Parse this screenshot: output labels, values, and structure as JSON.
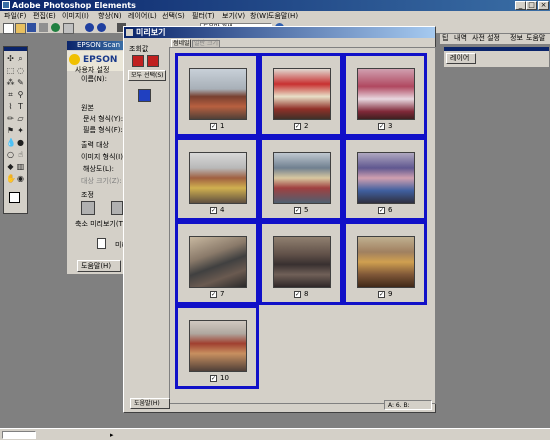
{
  "app": {
    "title": "Adobe Photoshop Elements",
    "menu": [
      "파일(F)",
      "편집(E)",
      "이미지(I)",
      "향상(N)",
      "레이어(L)",
      "선택(S)",
      "필터(T)",
      "보기(V)",
      "창(W)",
      "도움말(H)"
    ],
    "help_search": "도움말 검색",
    "right_tabs": [
      "팁",
      "내역",
      "사전 설정",
      "정보",
      "도움말"
    ],
    "right_panel_label": "레이어"
  },
  "epson": {
    "title": "EPSON Scan",
    "brand": "EPSON",
    "setting_label": "사용자 설정",
    "setting_name": "이름(N):",
    "sections": [
      "원본",
      "출력 대상",
      "조정"
    ],
    "items": [
      "문서 형식(Y):",
      "필름 형식(F):",
      "이미지 형식(I):",
      "해상도(L):",
      "대상 크기(Z):",
      "축소 미리보기(T)"
    ],
    "buttons": [
      "미리보기",
      "도움말(H)"
    ]
  },
  "preview_dialog": {
    "title": "미리보기",
    "tabs": [
      "썸네일",
      "일반 크기"
    ],
    "zoom_label": "조회값",
    "select_all": "모두 선택(S)",
    "help_button": "도움말(H)",
    "status": "A: 6. B:",
    "thumbnails": [
      {
        "label": "1",
        "checked": true
      },
      {
        "label": "2",
        "checked": true
      },
      {
        "label": "3",
        "checked": true
      },
      {
        "label": "4",
        "checked": true
      },
      {
        "label": "5",
        "checked": true
      },
      {
        "label": "6",
        "checked": true
      },
      {
        "label": "7",
        "checked": true
      },
      {
        "label": "8",
        "checked": true
      },
      {
        "label": "9",
        "checked": true
      },
      {
        "label": "10",
        "checked": true
      }
    ]
  },
  "colors": {
    "selection_border": "#1010c8",
    "title_bar": "#0a246a"
  }
}
